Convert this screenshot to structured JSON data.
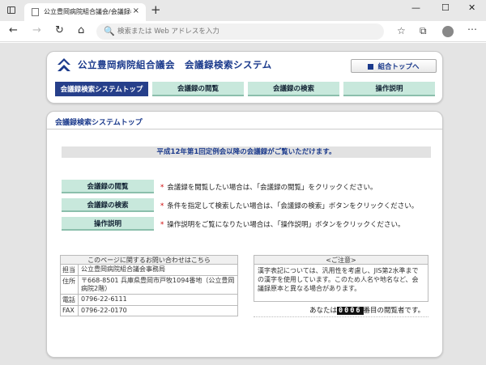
{
  "browser": {
    "tab_title": "公立豊岡病院組合議会/会議録検索",
    "tab_close": "×",
    "new_tab": "+",
    "window_minimize": "—",
    "window_maximize": "☐",
    "window_close": "✕",
    "address_placeholder": "検索または Web アドレスを入力",
    "nav_back": "←",
    "nav_forward": "→",
    "nav_refresh": "↻",
    "nav_home": "⌂",
    "search_icon": "🔍",
    "favorites_icon": "☆",
    "collections_icon": "⧉",
    "more_icon": "⋯"
  },
  "header": {
    "site_title": "公立豊岡病院組合議会　会議録検索システム",
    "top_link": "組合トップへ",
    "menu": [
      {
        "label": "会議録検索システムトップ"
      },
      {
        "label": "会議録の閲覧"
      },
      {
        "label": "会議録の検索"
      },
      {
        "label": "操作説明"
      }
    ]
  },
  "main": {
    "title": "会議録検索システムトップ",
    "notice": "平成12年第1回定例会以降の会議録がご覧いただけます。",
    "actions": [
      {
        "button": "会議録の閲覧",
        "desc": "会議録を閲覧したい場合は、「会議録の閲覧」をクリックください。"
      },
      {
        "button": "会議録の検索",
        "desc": "条件を指定して検索したい場合は、「会議録の検索」ボタンをクリックください。"
      },
      {
        "button": "操作説明",
        "desc": "操作説明をご覧になりたい場合は、「操作説明」ボタンをクリックください。"
      }
    ],
    "star": "*",
    "contact": {
      "heading": "このページに関するお問い合わせはこちら",
      "rows": [
        {
          "key": "担当",
          "value": "公立豊岡病院組合議会事務局"
        },
        {
          "key": "住所",
          "value": "〒668-8501 兵庫県豊岡市戸牧1094番地（公立豊岡病院2階）"
        },
        {
          "key": "電話",
          "value": "0796-22-6111"
        },
        {
          "key": "FAX",
          "value": "0796-22-0170"
        }
      ]
    },
    "caution": {
      "heading": "<ご注意>",
      "body": "漢字表記については、汎用性を考慮し、JIS第2水準までの漢字を使用しています。このため人名や地名など、会議録原本と異なる場合があります。"
    },
    "counter": {
      "prefix": "あなたは",
      "digits": "0006",
      "suffix": "番目の閲覧者です。"
    }
  },
  "colors": {
    "brand_navy": "#1b3a8c",
    "menu_active": "#263f8a",
    "menu_green": "#c8e8dc",
    "star_red": "#cc0000"
  }
}
